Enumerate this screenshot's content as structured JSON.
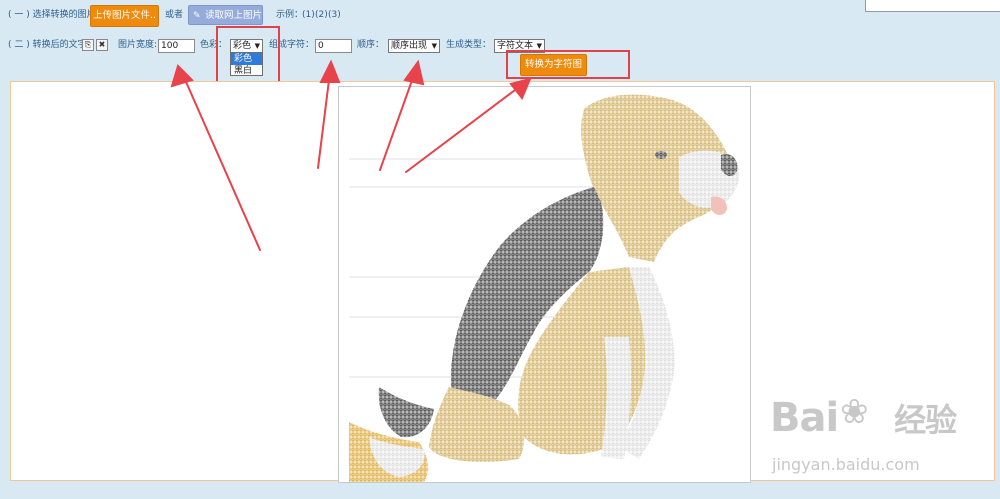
{
  "row1": {
    "label": "( 一 ) 选择转换的图片:",
    "upload_button": "上传图片文件..",
    "or_text": "或者",
    "read_online_button": "读取网上图片",
    "examples_label": "示例：",
    "examples": [
      "(1)",
      "(2)",
      "(3)"
    ]
  },
  "row2": {
    "label": "( 二 ) 转换后的文字:",
    "width_label": "图片宽度:",
    "width_value": "100",
    "color_label": "色彩：",
    "color_selected": "彩色",
    "color_options": [
      "彩色",
      "黑白"
    ],
    "chars_label": "组成字符：",
    "chars_value": "0",
    "order_label": "顺序：",
    "order_selected": "顺序出现",
    "gen_type_label": "生成类型：",
    "gen_type_selected": "字符文本",
    "convert_button": "转换为字符图"
  },
  "watermark": {
    "brand": "Bai",
    "brand_suffix": "经验",
    "url": "jingyan.baidu.com"
  },
  "colors": {
    "accent_orange": "#ee8a0c",
    "blue_button": "#95abd9",
    "annotation_red": "#e0424a",
    "page_bg": "#d8e9f4"
  }
}
